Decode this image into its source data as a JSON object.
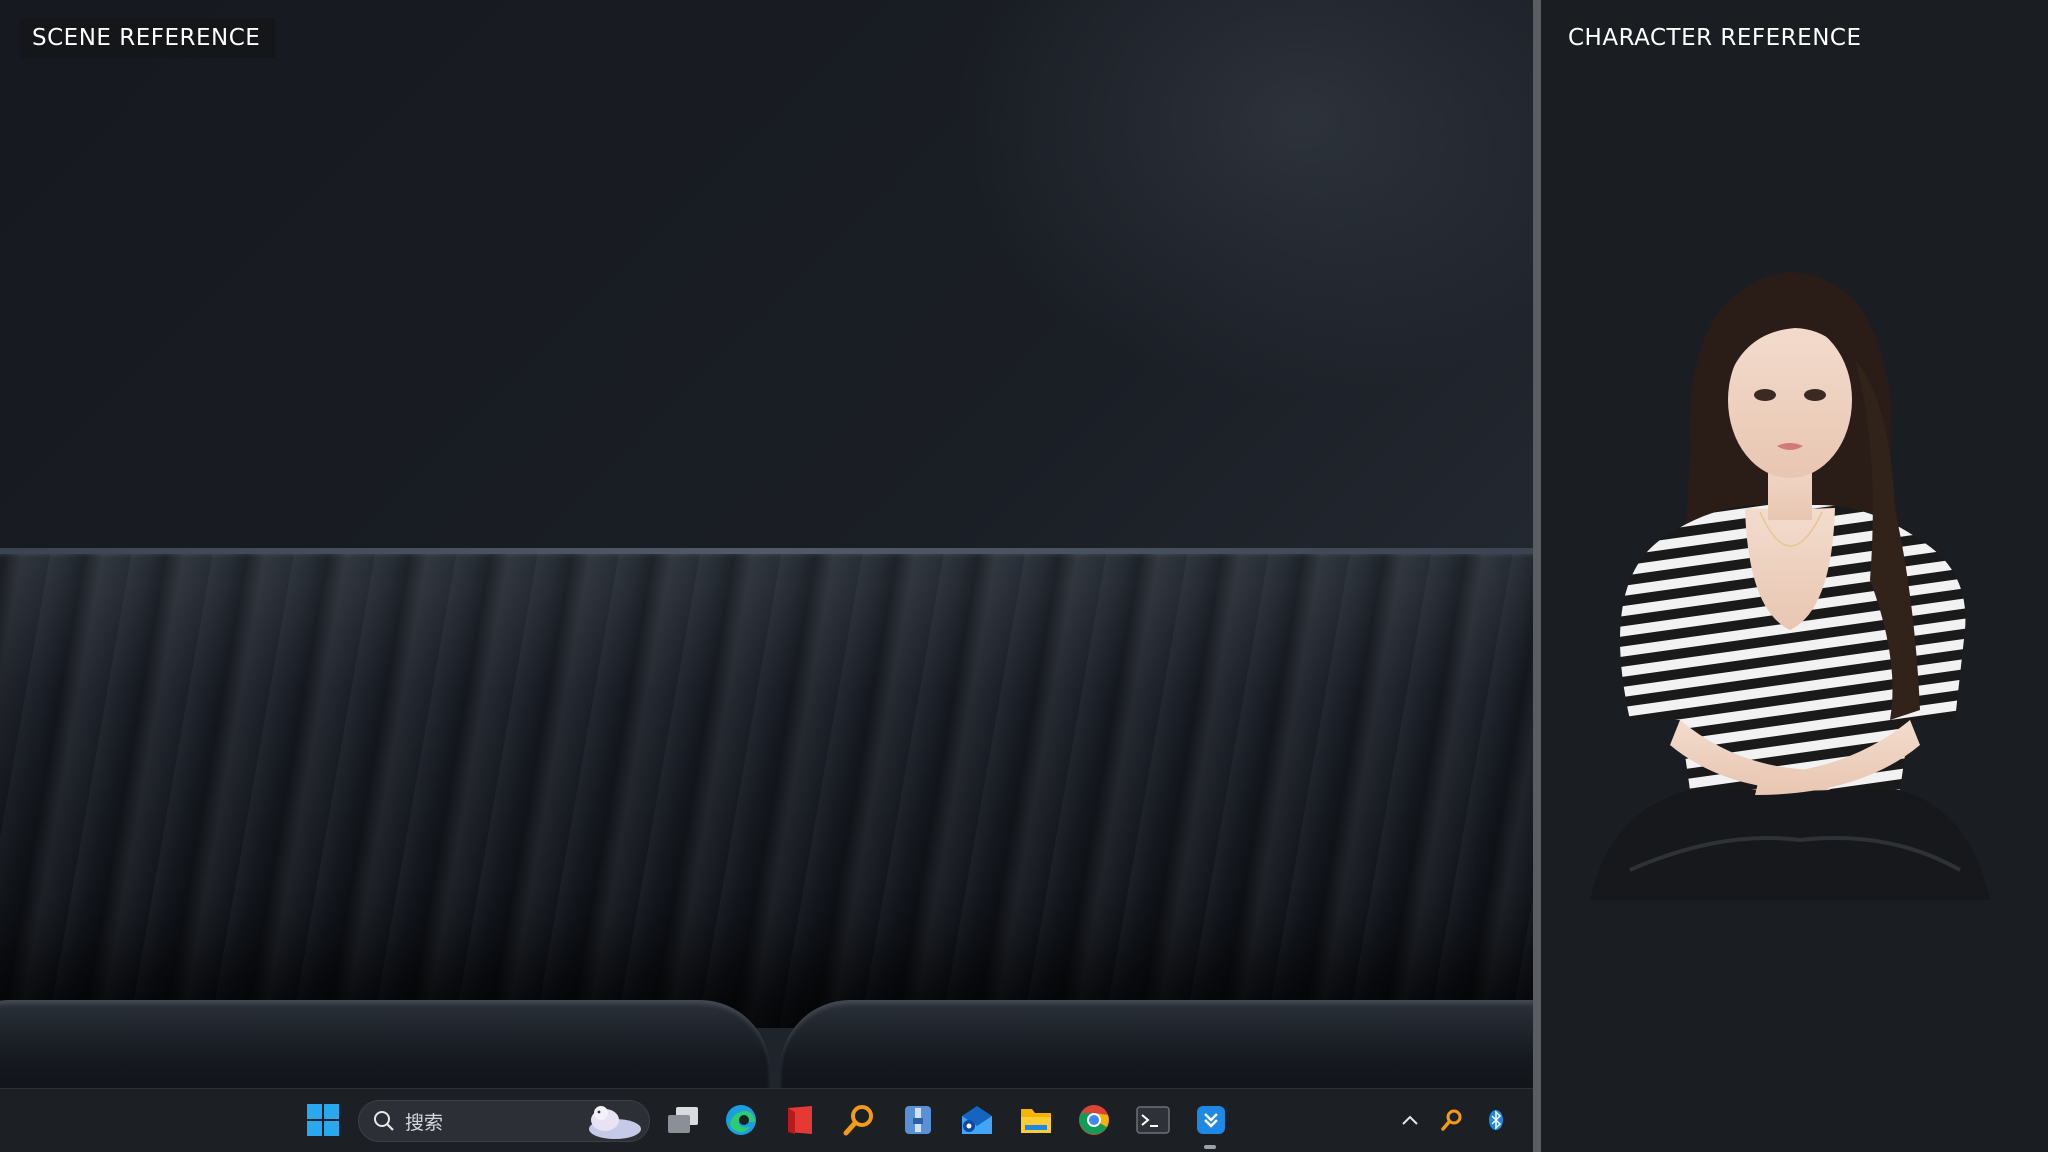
{
  "panels": {
    "scene_label": "SCENE REFERENCE",
    "character_label": "CHARACTER REFERENCE"
  },
  "taskbar": {
    "search_placeholder": "搜索",
    "apps": [
      "start-icon",
      "task-view-icon",
      "edge-icon",
      "red-app-icon",
      "magnifier-icon",
      "archive-app-icon",
      "mail-app-icon",
      "file-explorer-icon",
      "chrome-icon",
      "terminal-icon",
      "download-app-icon"
    ],
    "tray": [
      "show-hidden-icons-chevron",
      "search-tray-icon",
      "bluetooth-icon"
    ]
  },
  "colors": {
    "accent_blue": "#1e88e5",
    "windows_blue": "#29a8f0",
    "orange": "#f39c12",
    "panel_bg": "#1a1d22",
    "divider": "#5a5e63"
  }
}
